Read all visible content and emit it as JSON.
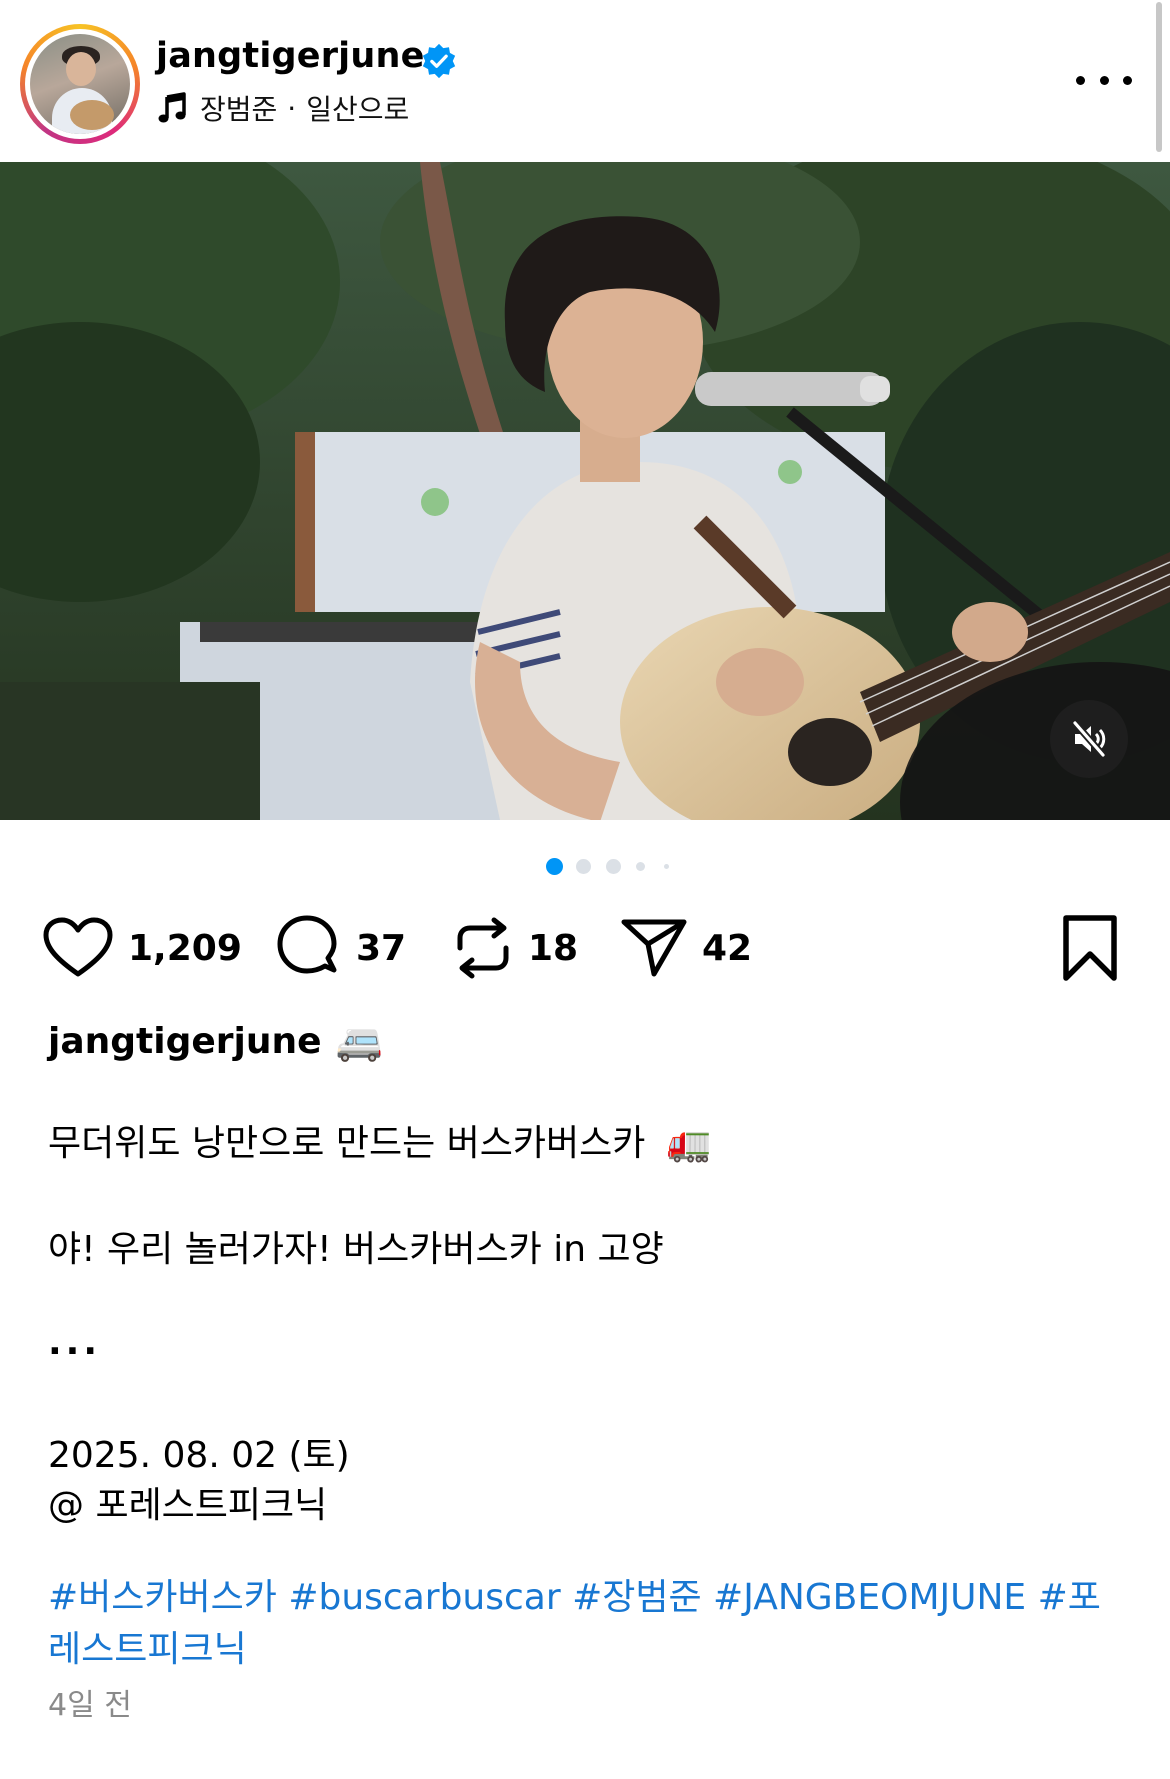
{
  "header": {
    "username": "jangtigerjune",
    "verified": true,
    "music_artist": "장범준",
    "separator": "·",
    "music_title": "일산으로"
  },
  "post": {
    "media_count": 5,
    "current_index": 1,
    "muted": true
  },
  "actions": {
    "likes": "1,209",
    "comments": "37",
    "reposts": "18",
    "shares": "42"
  },
  "caption": {
    "username": "jangtigerjune",
    "username_emoji": "🚐",
    "line1": "무더위도 낭만으로 만드는 버스카버스카",
    "line1_emoji": "🚛",
    "line2": "야! 우리 놀러가자! 버스카버스카 in 고양",
    "ellipsis": "...",
    "date_line": "2025. 08. 02 (토)",
    "location_line": "@ 포레스트피크닉",
    "hashtags": "#버스카버스카 #buscarbuscar #장범준 #JANGBEOMJUNE #포레스트피크닉"
  },
  "timestamp": "4일 전",
  "colors": {
    "accent": "#0095f6",
    "hashtag": "#1877d2",
    "verified": "#0095f6",
    "dot_inactive": "#d8dde3"
  }
}
